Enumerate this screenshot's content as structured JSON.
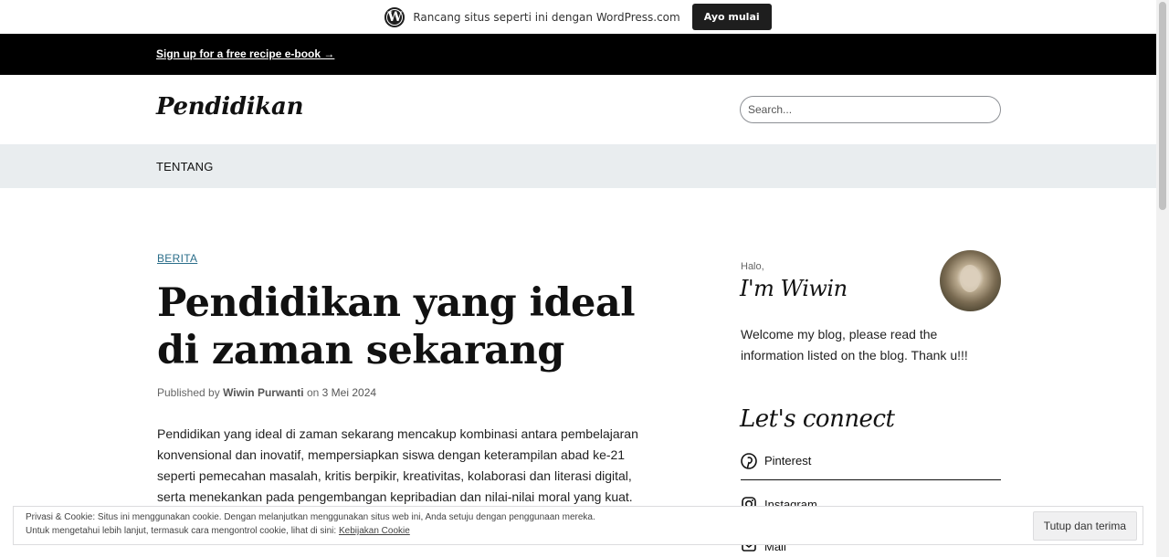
{
  "wp_bar": {
    "text": "Rancang situs seperti ini dengan WordPress.com",
    "button": "Ayo mulai",
    "logo_icon": "wordpress-logo-icon"
  },
  "banner": {
    "link": "Sign up for a free recipe e-book →"
  },
  "header": {
    "site_title": "Pendidikan",
    "search_placeholder": "Search..."
  },
  "nav": {
    "items": [
      {
        "label": "TENTANG"
      }
    ]
  },
  "post": {
    "category": "BERITA",
    "title": "Pendidikan yang ideal di zaman sekarang",
    "meta_prefix": "Published by",
    "author": "Wiwin Purwanti",
    "meta_on": "on",
    "date": "3 Mei 2024",
    "excerpt": "Pendidikan yang ideal di zaman sekarang mencakup kombinasi antara pembelajaran konvensional dan inovatif, mempersiapkan siswa dengan keterampilan abad ke-21 seperti pemecahan masalah, kritis berpikir, kreativitas, kolaborasi dan literasi digital, serta menekankan pada pengembangan kepribadian dan nilai-nilai moral yang kuat."
  },
  "sidebar": {
    "greeting": "Halo,",
    "name": "I'm Wiwin",
    "welcome": "Welcome my blog, please read the information listed on the blog. Thank u!!!",
    "connect_title": "Let's connect",
    "social": [
      {
        "label": "Pinterest",
        "icon": "pinterest-icon"
      },
      {
        "label": "Instagram",
        "icon": "instagram-icon"
      },
      {
        "label": "Mail",
        "icon": "mail-icon"
      }
    ]
  },
  "cookie": {
    "line1": "Privasi & Cookie: Situs ini menggunakan cookie. Dengan melanjutkan menggunakan situs web ini, Anda setuju dengan penggunaan mereka.",
    "line2_prefix": "Untuk mengetahui lebih lanjut, termasuk cara mengontrol cookie, lihat di sini:",
    "line2_link": "Kebijakan Cookie",
    "button": "Tutup dan terima"
  }
}
